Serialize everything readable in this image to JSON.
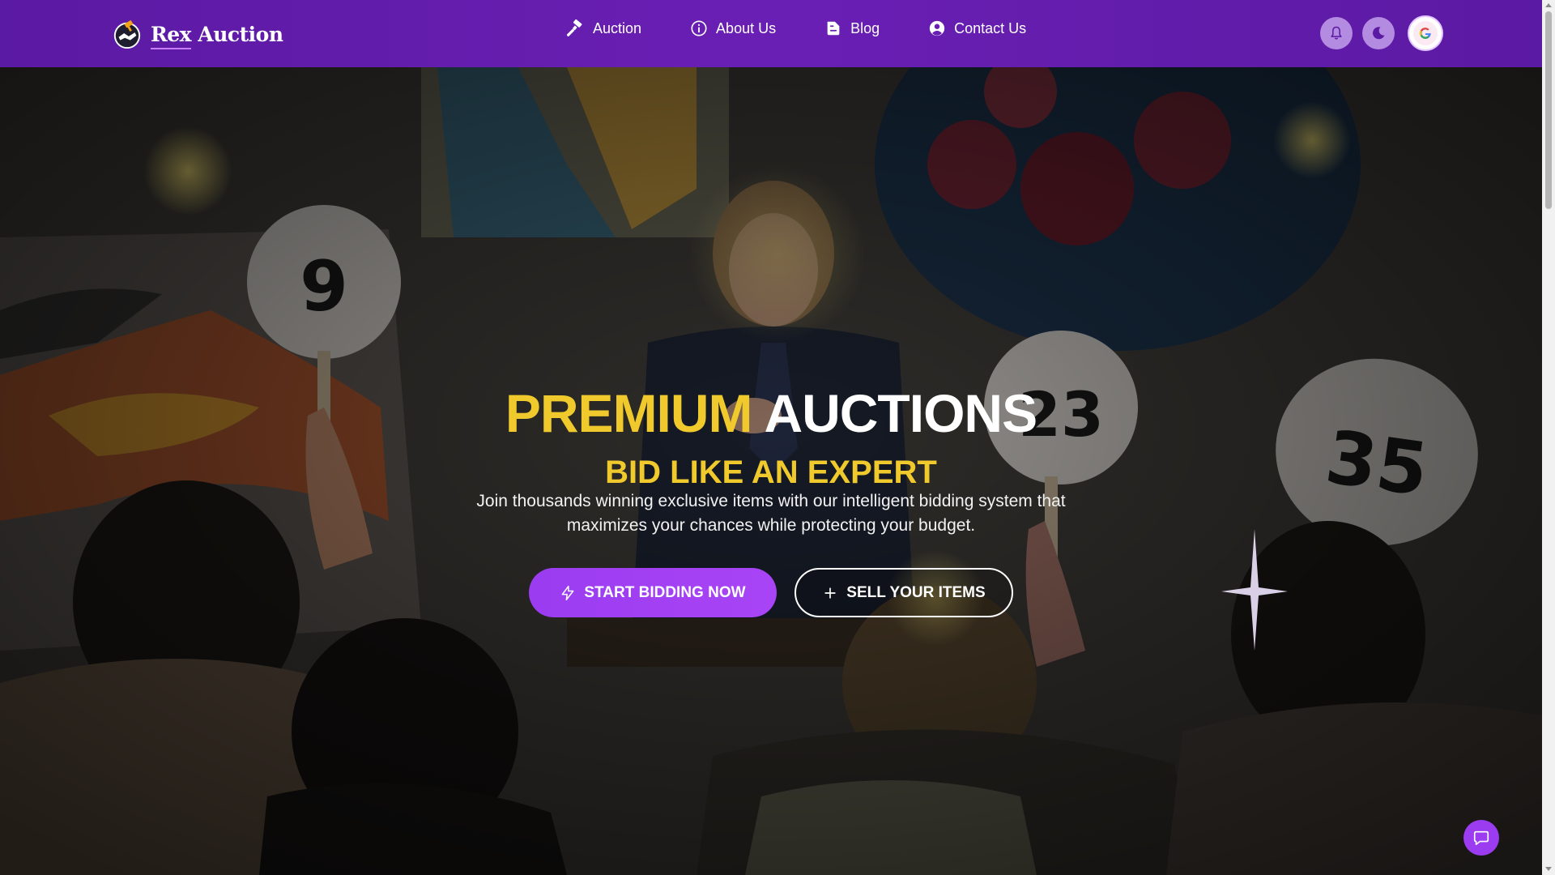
{
  "brand": {
    "name_part1": "Rex",
    "name_part2": " Auction",
    "logo_icon": "handshake-gavel-logo"
  },
  "nav": {
    "links": [
      {
        "label": "Auction",
        "icon": "gavel-icon"
      },
      {
        "label": "About Us",
        "icon": "info-circle-icon"
      },
      {
        "label": "Blog",
        "icon": "blog-icon"
      },
      {
        "label": "Contact Us",
        "icon": "user-circle-icon"
      }
    ],
    "actions": {
      "notifications_icon": "bell-icon",
      "theme_icon": "moon-icon",
      "avatar_icon": "google-avatar-icon"
    }
  },
  "hero": {
    "headline_part1": "PREMIUM",
    "headline_part2": "AUCTIONS",
    "subheadline": "BID LIKE AN EXPERT",
    "description": "Join thousands winning exclusive items with our intelligent bidding system that maximizes your chances while protecting your budget.",
    "primary_button": {
      "label": "START BIDDING NOW",
      "icon": "bolt-icon"
    },
    "secondary_button": {
      "label": "SELL YOUR ITEMS",
      "icon": "plus-icon"
    },
    "paddle_numbers": [
      "9",
      "23",
      "35"
    ]
  },
  "chat_button": {
    "icon": "chat-bubble-icon"
  },
  "colors": {
    "nav_bg": "#6a1fb4",
    "accent_yellow": "#f0c92c",
    "primary_purple": "#9b3cf0",
    "icon_button_bg": "#b38be0"
  }
}
